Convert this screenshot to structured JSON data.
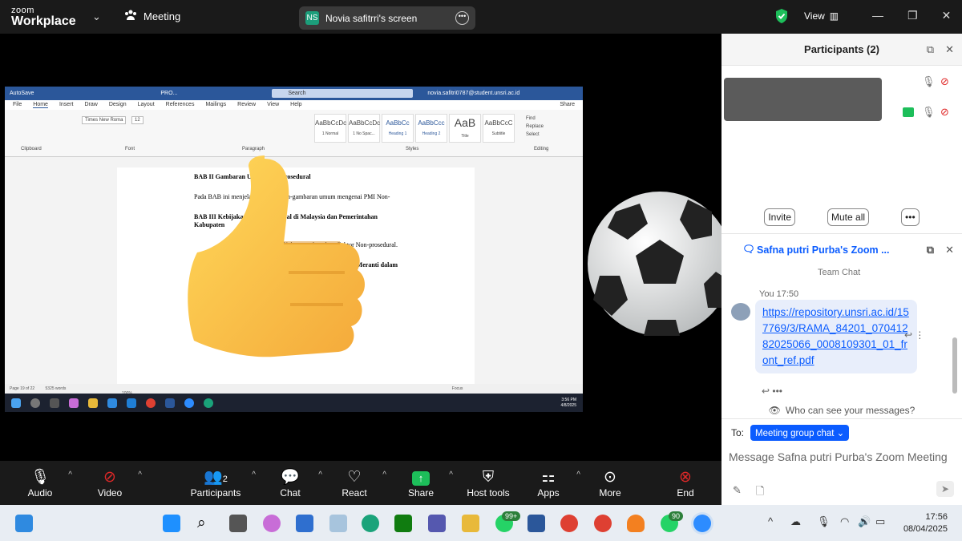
{
  "topbar": {
    "brand_small": "zoom",
    "brand_large": "Workplace",
    "meeting_label": "Meeting",
    "share_initials": "NS",
    "share_title": "Novia safitrri's screen",
    "view_label": "View"
  },
  "word": {
    "autosave": "AutoSave",
    "doc_name": "PRO...",
    "search_placeholder": "Search",
    "account": "novia.safitri0787@student.unsri.ac.id",
    "menu": [
      "File",
      "Home",
      "Insert",
      "Draw",
      "Design",
      "Layout",
      "References",
      "Mailings",
      "Review",
      "View",
      "Help"
    ],
    "share": "Share",
    "font": "Times New Roma",
    "font_size": "12",
    "styles": [
      {
        "sample": "AaBbCcDc",
        "name": "1 Normal"
      },
      {
        "sample": "AaBbCcDc",
        "name": "1 No Spac..."
      },
      {
        "sample": "AaBbCc",
        "name": "Heading 1"
      },
      {
        "sample": "AaBbCcc",
        "name": "Heading 2"
      },
      {
        "sample": "AaB",
        "name": "Title"
      },
      {
        "sample": "AaBbCcC",
        "name": "Subtitle"
      }
    ],
    "editing": [
      "Find",
      "Replace",
      "Select"
    ],
    "groups": [
      "Clipboard",
      "Font",
      "Paragraph",
      "Styles",
      "Editing"
    ],
    "lines": [
      "BAB II Gambaran Umum Non-prosedural",
      "Pada BAB ini menjelaskan gambaran-gambaran umum mengenai PMI Non-",
      "BAB III Kebijakan Non-prosedural di Malaysia dan Pemerintahan Kabupaten",
      "profil Kabupaten kepulaua Faktor Non-prosedural.",
      "Kabupaten Kepulauan Meranti dalam",
      "Dalam BAB ini membahas tentang upaya kebijakan dari"
    ],
    "status_page": "Page 19 of 22",
    "status_words": "5325 words",
    "status_focus": "Focus",
    "zoom": "100%",
    "time": "3:56 PM",
    "date": "4/8/2025"
  },
  "participants": {
    "title": "Participants (2)",
    "invite": "Invite",
    "mute_all": "Mute all"
  },
  "chat": {
    "title": "Safna putri Purba's Zoom ...",
    "team_chat": "Team Chat",
    "sender": "You 17:50",
    "link": "https://repository.unsri.ac.id/157769/3/RAMA_84201_07041282025066_0008109301_01_front_ref.pdf",
    "who_can_see": "Who can see your messages?",
    "to_label": "To:",
    "to_value": "Meeting group chat",
    "message_placeholder": "Message Safna putri Purba's Zoom Meeting"
  },
  "toolbar": {
    "audio": "Audio",
    "video": "Video",
    "participants": "Participants",
    "participants_count": "2",
    "chat": "Chat",
    "react": "React",
    "share": "Share",
    "host_tools": "Host tools",
    "apps": "Apps",
    "more": "More",
    "end": "End"
  },
  "taskbar": {
    "whatsapp_badge": "99+",
    "whatsapp2_badge": "90",
    "time": "17:56",
    "date": "08/04/2025"
  },
  "colors": {
    "zoom_blue": "#0b5cff",
    "share_green": "#1dbe5a",
    "end_red": "#e02828",
    "word_blue": "#2b579a"
  }
}
